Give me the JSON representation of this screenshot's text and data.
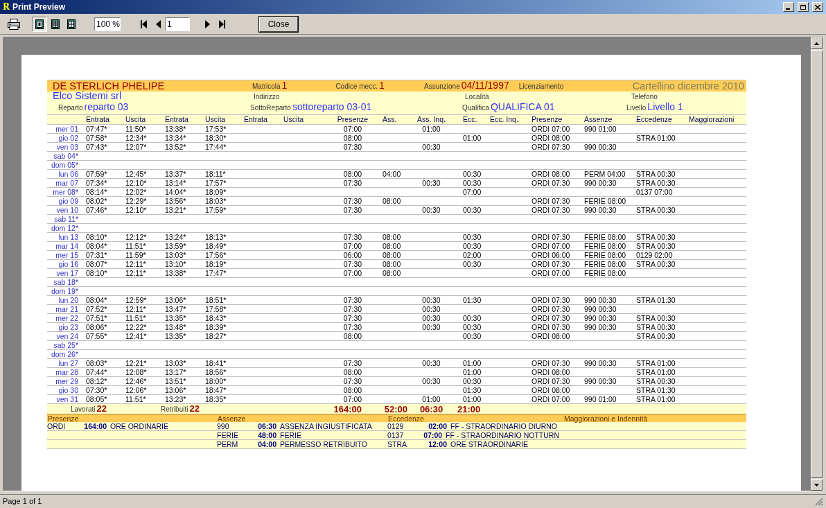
{
  "window": {
    "title": "Print Preview",
    "app_icon": "R"
  },
  "toolbar": {
    "views": [
      {
        "selected": true
      },
      {
        "selected": false
      },
      {
        "selected": false
      }
    ],
    "zoom": "100 %",
    "page": "1",
    "close": "Close"
  },
  "header": {
    "name": "DE STERLICH PHELIPE",
    "title": "Cartellino dicembre 2010",
    "matricola": {
      "label": "Matricola",
      "value": "1"
    },
    "codice": {
      "label": "Codice mecc.",
      "value": "1"
    },
    "assunzione": {
      "label": "Assunzione",
      "value": "04/11/1997"
    },
    "licenziamento": {
      "label": "Licenziamento"
    },
    "company": "Elco Sistemi srl",
    "indirizzo": {
      "label": "Indirizzo"
    },
    "localita": {
      "label": "Località"
    },
    "telefono": {
      "label": "Telefono"
    },
    "reparto": {
      "label": "Reparto",
      "value": "reparto 03"
    },
    "sottoreparto": {
      "label": "SottoReparto",
      "value": "sottoreparto 03-01"
    },
    "qualifica": {
      "label": "Qualifica",
      "value": "QUALIFICA 01"
    },
    "livello": {
      "label": "Livello",
      "value": "Livello 1"
    }
  },
  "table": {
    "columns": [
      "Entrata",
      "Uscita",
      "Entrata",
      "Uscita",
      "Entrata",
      "Uscita",
      "Presenze",
      "Ass.",
      "Ass. Inq.",
      "Ecc.",
      "Ecc. Inq.",
      "Presenze",
      "Assenze",
      "Eccedenze",
      "Maggiorazioni"
    ],
    "rows": [
      {
        "day": "mer 01",
        "cells": [
          "07:47*",
          "11:50*",
          "13:38*",
          "17:53*",
          null,
          null,
          "07:00",
          null,
          "01:00",
          null,
          null,
          "ORDI 07:00",
          "990 01:00",
          null,
          null
        ]
      },
      {
        "day": "gio 02",
        "cells": [
          "07:58*",
          "12:34*",
          "13:34*",
          "18:30*",
          null,
          null,
          "08:00",
          null,
          null,
          "01:00",
          null,
          "ORDI 08:00",
          null,
          "STRA 01:00",
          null
        ]
      },
      {
        "day": "ven 03",
        "cells": [
          "07:43*",
          "12:07*",
          "13:52*",
          "17:44*",
          null,
          null,
          "07:30",
          null,
          "00:30",
          null,
          null,
          "ORDI 07:30",
          "990 00:30",
          null,
          null
        ]
      },
      {
        "day": "sab 04*",
        "cells": []
      },
      {
        "day": "dom 05*",
        "cells": []
      },
      {
        "day": "lun 06",
        "cells": [
          "07:59*",
          "12:45*",
          "13:37*",
          "18:11*",
          null,
          null,
          "08:00",
          "04:00",
          null,
          "00:30",
          null,
          "ORDI 08:00",
          "PERM 04:00",
          "STRA 00:30",
          null
        ]
      },
      {
        "day": "mar 07",
        "cells": [
          "07:34*",
          "12:10*",
          "13:14*",
          "17:57*",
          null,
          null,
          "07:30",
          null,
          "00:30",
          "00:30",
          null,
          "ORDI 07:30",
          "990 00:30",
          "STRA 00:30",
          null
        ]
      },
      {
        "day": "mer 08*",
        "cells": [
          "08:14*",
          "12:02*",
          "14:04*",
          "18:09*",
          null,
          null,
          null,
          null,
          null,
          "07:00",
          null,
          null,
          null,
          "0137 07:00",
          null
        ]
      },
      {
        "day": "gio 09",
        "cells": [
          "08:02*",
          "12:29*",
          "13:56*",
          "18:03*",
          null,
          null,
          "07:30",
          "08:00",
          null,
          null,
          null,
          "ORDI 07:30",
          "FERIE 08:00",
          null,
          null
        ]
      },
      {
        "day": "ven 10",
        "cells": [
          "07:46*",
          "12:10*",
          "13:21*",
          "17:59*",
          null,
          null,
          "07:30",
          null,
          "00:30",
          "00:30",
          null,
          "ORDI 07:30",
          "990 00:30",
          "STRA 00:30",
          null
        ]
      },
      {
        "day": "sab 11*",
        "cells": []
      },
      {
        "day": "dom 12*",
        "cells": []
      },
      {
        "day": "lun 13",
        "cells": [
          "08:10*",
          "12:12*",
          "13:24*",
          "18:13*",
          null,
          null,
          "07:30",
          "08:00",
          null,
          "00:30",
          null,
          "ORDI 07:30",
          "FERIE 08:00",
          "STRA 00:30",
          null
        ]
      },
      {
        "day": "mar 14",
        "cells": [
          "08:04*",
          "11:51*",
          "13:59*",
          "18:49*",
          null,
          null,
          "07:00",
          "08:00",
          null,
          "00:30",
          null,
          "ORDI 07:00",
          "FERIE 08:00",
          "STRA 00:30",
          null
        ]
      },
      {
        "day": "mer 15",
        "cells": [
          "07:31*",
          "11:59*",
          "13:03*",
          "17:56*",
          null,
          null,
          "06:00",
          "08:00",
          null,
          "02:00",
          null,
          "ORDI 06:00",
          "FERIE 08:00",
          "0129 02:00",
          null
        ]
      },
      {
        "day": "gio 16",
        "cells": [
          "08:07*",
          "12:11*",
          "13:10*",
          "18:19*",
          null,
          null,
          "07:30",
          "08:00",
          null,
          "00:30",
          null,
          "ORDI 07:30",
          "FERIE 08:00",
          "STRA 00:30",
          null
        ]
      },
      {
        "day": "ven 17",
        "cells": [
          "08:10*",
          "12:11*",
          "13:38*",
          "17:47*",
          null,
          null,
          "07:00",
          "08:00",
          null,
          null,
          null,
          "ORDI 07:00",
          "FERIE 08:00",
          null,
          null
        ]
      },
      {
        "day": "sab 18*",
        "cells": []
      },
      {
        "day": "dom 19*",
        "cells": []
      },
      {
        "day": "lun 20",
        "cells": [
          "08:04*",
          "12:59*",
          "13:06*",
          "18:51*",
          null,
          null,
          "07:30",
          null,
          "00:30",
          "01:30",
          null,
          "ORDI 07:30",
          "990 00:30",
          "STRA 01:30",
          null
        ]
      },
      {
        "day": "mar 21",
        "cells": [
          "07:52*",
          "12:11*",
          "13:47*",
          "17:58*",
          null,
          null,
          "07:30",
          null,
          "00:30",
          null,
          null,
          "ORDI 07:30",
          "990 00:30",
          null,
          null
        ]
      },
      {
        "day": "mer 22",
        "cells": [
          "07:51*",
          "11:51*",
          "13:35*",
          "18:43*",
          null,
          null,
          "07:30",
          null,
          "00:30",
          "00:30",
          null,
          "ORDI 07:30",
          "990 00:30",
          "STRA 00:30",
          null
        ]
      },
      {
        "day": "gio 23",
        "cells": [
          "08:06*",
          "12:22*",
          "13:48*",
          "18:39*",
          null,
          null,
          "07:30",
          null,
          "00:30",
          "00:30",
          null,
          "ORDI 07:30",
          "990 00:30",
          "STRA 00:30",
          null
        ]
      },
      {
        "day": "ven 24",
        "cells": [
          "07:55*",
          "12:41*",
          "13:35*",
          "18:27*",
          null,
          null,
          "08:00",
          null,
          null,
          "00:30",
          null,
          "ORDI 08:00",
          null,
          "STRA 00:30",
          null
        ]
      },
      {
        "day": "sab 25*",
        "cells": []
      },
      {
        "day": "dom 26*",
        "cells": []
      },
      {
        "day": "lun 27",
        "cells": [
          "08:03*",
          "12:21*",
          "13:03*",
          "18:41*",
          null,
          null,
          "07:30",
          null,
          "00:30",
          "01:00",
          null,
          "ORDI 07:30",
          "990 00:30",
          "STRA 01:00",
          null
        ]
      },
      {
        "day": "mar 28",
        "cells": [
          "07:44*",
          "12:08*",
          "13:17*",
          "18:56*",
          null,
          null,
          "08:00",
          null,
          null,
          "01:00",
          null,
          "ORDI 08:00",
          null,
          "STRA 01:00",
          null
        ]
      },
      {
        "day": "mer 29",
        "cells": [
          "08:12*",
          "12:46*",
          "13:51*",
          "18:00*",
          null,
          null,
          "07:30",
          null,
          "00:30",
          "00:30",
          null,
          "ORDI 07:30",
          "990 00:30",
          "STRA 00:30",
          null
        ]
      },
      {
        "day": "gio 30",
        "cells": [
          "07:30*",
          "12:06*",
          "13:06*",
          "18:47*",
          null,
          null,
          "08:00",
          null,
          null,
          "01:30",
          null,
          "ORDI 08:00",
          null,
          "STRA 01:30",
          null
        ]
      },
      {
        "day": "ven 31",
        "cells": [
          "08:05*",
          "11:51*",
          "13:23*",
          "18:35*",
          null,
          null,
          "07:00",
          null,
          "01:00",
          "01:00",
          null,
          "ORDI 07:00",
          "990 01:00",
          "STRA 01:00",
          null
        ]
      }
    ],
    "totals": {
      "worked": {
        "label": "Lavorati",
        "value": "22"
      },
      "paid": {
        "label": "Retribuiti",
        "value": "22"
      },
      "values": [
        "164:00",
        "52:00",
        "06:30",
        "21:00"
      ]
    }
  },
  "summary": {
    "headings": [
      "Presenze",
      "Assenze",
      "Eccedenze",
      "Maggiorazioni e Indennità"
    ],
    "presenze": [
      {
        "code": "ORDI",
        "hours": "164:00",
        "description": "ORE ORDINARIE"
      }
    ],
    "assenze": [
      {
        "code": "990",
        "hours": "06:30",
        "description": "ASSENZA INGIUSTIFICATA"
      },
      {
        "code": "FERIE",
        "hours": "48:00",
        "description": "FERIE"
      },
      {
        "code": "PERM",
        "hours": "04:00",
        "description": "PERMESSO RETRIBUITO"
      }
    ],
    "eccedenze": [
      {
        "code": "0129",
        "hours": "02:00",
        "description": "FF - STRAORDINARIO DIURNO"
      },
      {
        "code": "0137",
        "hours": "07:00",
        "description": "FF - STRAORDINARIO NOTTURN"
      },
      {
        "code": "STRA",
        "hours": "12:00",
        "description": "ORE STRAORDINARIE"
      }
    ]
  },
  "status_bar": {
    "text": "Page 1 of 1"
  }
}
